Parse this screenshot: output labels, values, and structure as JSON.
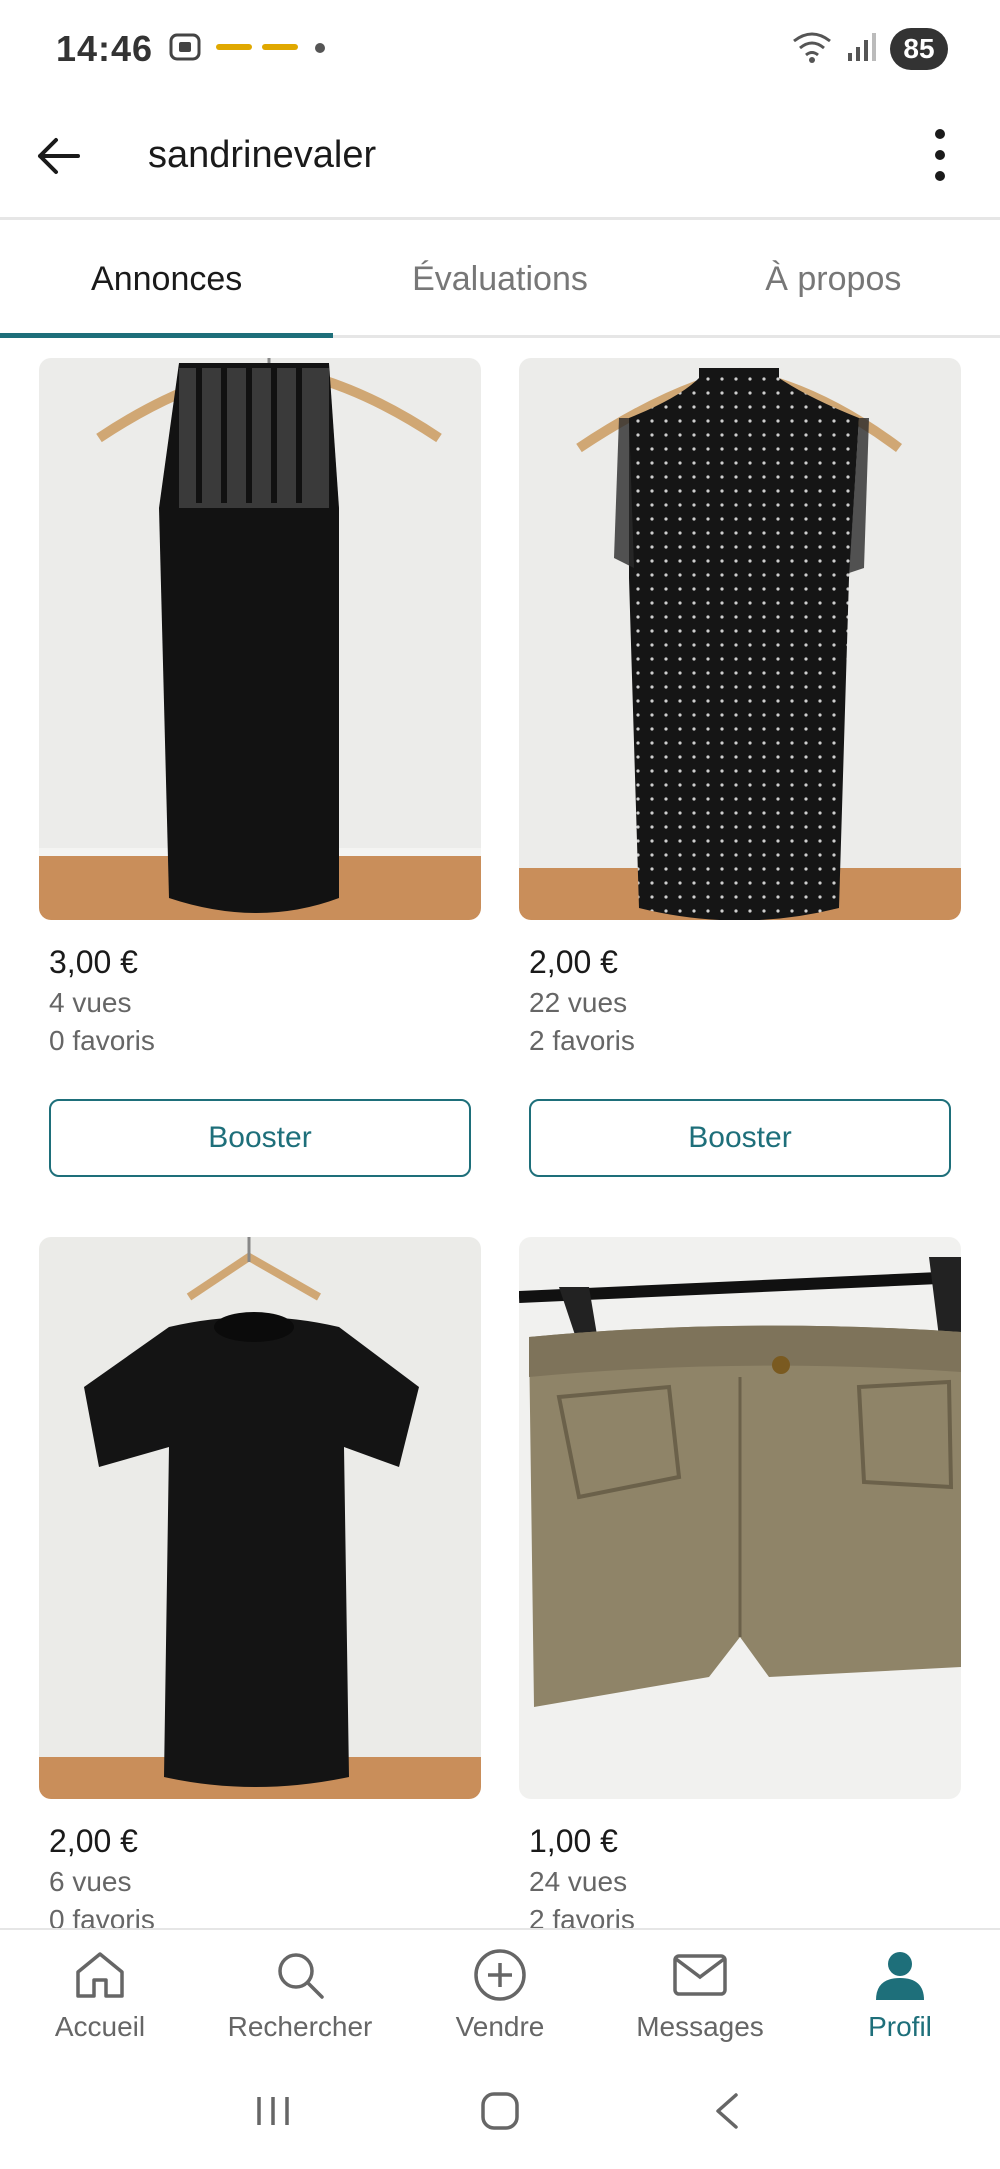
{
  "status_bar": {
    "time": "14:46",
    "battery": "85",
    "icons": [
      "screenshot-icon",
      "notification-icons",
      "dot-icon",
      "wifi-icon",
      "signal-icon",
      "battery-icon"
    ]
  },
  "header": {
    "title": "sandrinevaler",
    "back_icon": "arrow-left-icon",
    "more_icon": "more-vertical-icon"
  },
  "tabs": [
    {
      "label": "Annonces",
      "active": true
    },
    {
      "label": "Évaluations",
      "active": false
    },
    {
      "label": "À propos",
      "active": false
    }
  ],
  "listings": [
    {
      "price": "3,00 €",
      "views": "4 vues",
      "favorites": "0 favoris",
      "boost_label": "Booster",
      "image": "black-sleeveless-dress-lace-yoke"
    },
    {
      "price": "2,00 €",
      "views": "22 vues",
      "favorites": "2 favoris",
      "boost_label": "Booster",
      "image": "black-polka-dot-halter-dress"
    },
    {
      "price": "2,00 €",
      "views": "6 vues",
      "favorites": "0 favoris",
      "image": "black-textured-short-sleeve-dress"
    },
    {
      "price": "1,00 €",
      "views": "24 vues",
      "favorites": "2 favoris",
      "image": "khaki-shorts"
    }
  ],
  "bottom_nav": [
    {
      "label": "Accueil",
      "icon": "home-icon",
      "active": false
    },
    {
      "label": "Rechercher",
      "icon": "search-icon",
      "active": false
    },
    {
      "label": "Vendre",
      "icon": "plus-circle-icon",
      "active": false
    },
    {
      "label": "Messages",
      "icon": "mail-icon",
      "active": false
    },
    {
      "label": "Profil",
      "icon": "profile-icon",
      "active": true
    }
  ],
  "colors": {
    "accent": "#1e6f7a",
    "text": "#1a1a1a",
    "muted": "#666666",
    "divider": "#e6e6e6"
  }
}
